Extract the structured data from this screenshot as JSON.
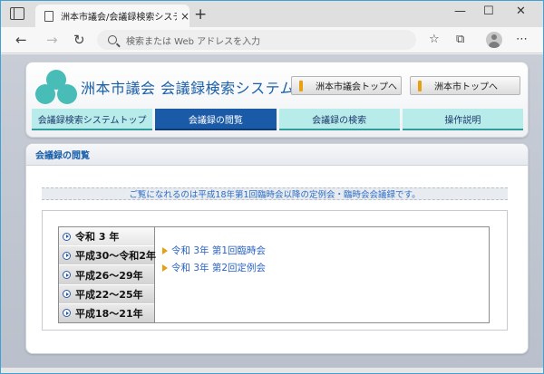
{
  "browser": {
    "tab_title": "洲本市議会/会議録検索システム",
    "tab_close": "×",
    "new_tab": "+",
    "address_placeholder": "検索または Web アドレスを入力",
    "win_minimize": "—",
    "win_maximize": "☐",
    "win_close": "✕"
  },
  "header": {
    "site_title": "洲本市議会 会議録検索システム",
    "link_council_top": "洲本市議会トップへ",
    "link_city_top": "洲本市トップへ",
    "logo_color": "#48bdb8"
  },
  "nav": {
    "items": [
      {
        "label": "会議録検索システムトップ",
        "active": false
      },
      {
        "label": "会議録の閲覧",
        "active": true
      },
      {
        "label": "会議録の検索",
        "active": false
      },
      {
        "label": "操作説明",
        "active": false
      }
    ]
  },
  "main": {
    "section_title": "会議録の閲覧",
    "notice": "ご覧になれるのは平成18年第1回臨時会以降の定例会・臨時会会議録です。",
    "years": [
      {
        "label": "令和 3 年"
      },
      {
        "label": "平成30〜令和2年"
      },
      {
        "label": "平成26〜29年"
      },
      {
        "label": "平成22〜25年"
      },
      {
        "label": "平成18〜21年"
      }
    ],
    "sessions": [
      {
        "label": "令和 3年 第1回臨時会"
      },
      {
        "label": "令和 3年 第2回定例会"
      }
    ]
  }
}
